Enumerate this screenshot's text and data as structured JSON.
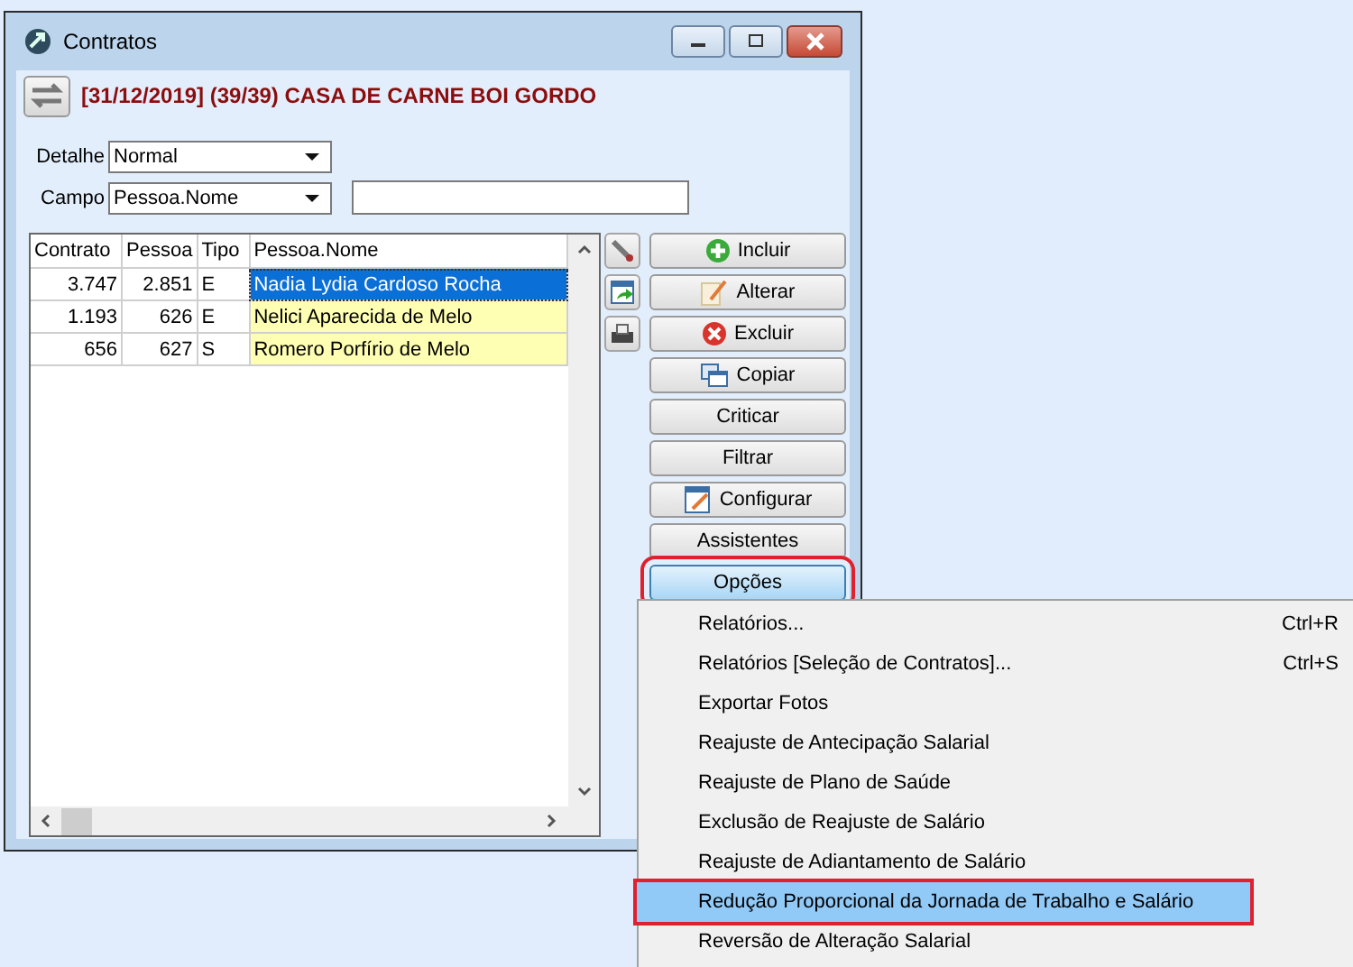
{
  "window": {
    "title": "Contratos"
  },
  "header": {
    "title": "[31/12/2019] (39/39) CASA DE CARNE BOI GORDO"
  },
  "filters": [
    {
      "label": "Detalhe",
      "value": "Normal"
    },
    {
      "label": "Campo",
      "value": "Pessoa.Nome"
    }
  ],
  "table": {
    "columns": [
      {
        "label": "Contrato"
      },
      {
        "label": "Pessoa"
      },
      {
        "label": "Tipo"
      },
      {
        "label": "Pessoa.Nome"
      }
    ],
    "rows": [
      {
        "cells": [
          "3.747",
          "2.851",
          "E",
          "Nadia Lydia Cardoso Rocha"
        ],
        "selected": true
      },
      {
        "cells": [
          "1.193",
          "626",
          "E",
          "Nelici Aparecida de Melo"
        ],
        "selected": false
      },
      {
        "cells": [
          "656",
          "627",
          "S",
          "Romero Porfírio de Melo"
        ],
        "selected": false
      }
    ]
  },
  "tool_buttons": [
    {
      "kind": "wrench"
    },
    {
      "kind": "export"
    },
    {
      "kind": "print"
    }
  ],
  "buttons": [
    {
      "label": "Incluir",
      "kind": "add",
      "pressed": false,
      "annotated": false
    },
    {
      "label": "Alterar",
      "kind": "edit",
      "pressed": false,
      "annotated": false
    },
    {
      "label": "Excluir",
      "kind": "delete",
      "pressed": false,
      "annotated": false
    },
    {
      "label": "Copiar",
      "kind": "copy",
      "pressed": false,
      "annotated": false
    },
    {
      "label": "Criticar",
      "kind": "text",
      "pressed": false,
      "annotated": false
    },
    {
      "label": "Filtrar",
      "kind": "text",
      "pressed": false,
      "annotated": false
    },
    {
      "label": "Configurar",
      "kind": "config",
      "pressed": false,
      "annotated": false
    },
    {
      "label": "Assistentes",
      "kind": "text",
      "pressed": false,
      "annotated": false
    },
    {
      "label": "Opções",
      "kind": "text",
      "pressed": true,
      "annotated": true
    }
  ],
  "menu": {
    "items": [
      {
        "label": "Relatórios...",
        "shortcut": "Ctrl+R",
        "selected": false,
        "annotated": false
      },
      {
        "label": "Relatórios [Seleção de Contratos]...",
        "shortcut": "Ctrl+S",
        "selected": false,
        "annotated": false
      },
      {
        "label": "Exportar Fotos",
        "selected": false,
        "annotated": false
      },
      {
        "label": "Reajuste de Antecipação Salarial",
        "selected": false,
        "annotated": false
      },
      {
        "label": "Reajuste de Plano de Saúde",
        "selected": false,
        "annotated": false
      },
      {
        "label": "Exclusão de Reajuste de Salário",
        "selected": false,
        "annotated": false
      },
      {
        "label": "Reajuste de Adiantamento de Salário",
        "selected": false,
        "annotated": false
      },
      {
        "label": "Redução Proporcional da Jornada de Trabalho e Salário",
        "selected": true,
        "annotated": true
      },
      {
        "label": "Reversão de Alteração Salarial",
        "selected": false,
        "annotated": false
      }
    ]
  }
}
